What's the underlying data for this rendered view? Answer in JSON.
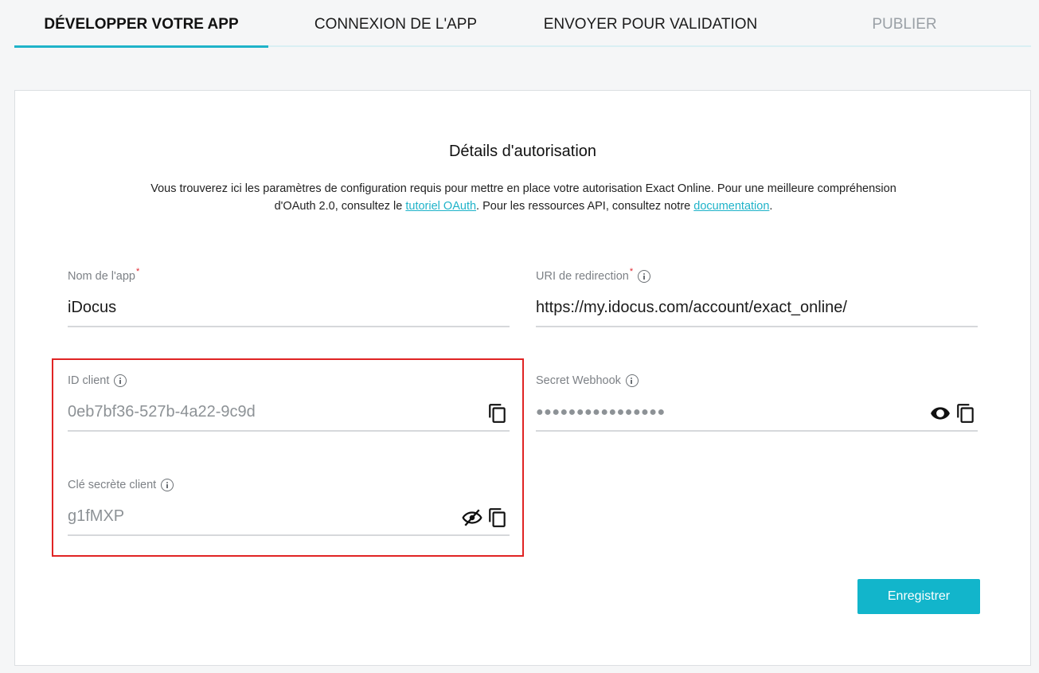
{
  "tabs": [
    {
      "label": "DÉVELOPPER VOTRE APP",
      "state": "active"
    },
    {
      "label": "CONNEXION DE L'APP",
      "state": "normal"
    },
    {
      "label": "ENVOYER POUR VALIDATION",
      "state": "normal"
    },
    {
      "label": "PUBLIER",
      "state": "disabled"
    }
  ],
  "card": {
    "title": "Détails d'autorisation",
    "desc_part1": "Vous trouverez ici les paramètres de configuration requis pour mettre en place votre autorisation Exact Online. Pour une meilleure compréhension d'OAuth 2.0, consultez le ",
    "desc_link1": "tutoriel OAuth",
    "desc_part2": ". Pour les ressources API, consultez notre ",
    "desc_link2": "documentation",
    "desc_part3": "."
  },
  "fields": {
    "app_name": {
      "label": "Nom de l'app",
      "required_mark": "*",
      "value": "iDocus"
    },
    "redirect_uri": {
      "label": "URI de redirection",
      "required_mark": "*",
      "value": "https://my.idocus.com/account/exact_online/"
    },
    "client_id": {
      "label": "ID client",
      "value": "0eb7bf36-527b-4a22-9c9d"
    },
    "webhook_secret": {
      "label": "Secret Webhook",
      "value": "●●●●●●●●●●●●●●●●"
    },
    "client_secret": {
      "label": "Clé secrète client",
      "value": "g1fMXP"
    }
  },
  "icons": {
    "info": "info-icon",
    "copy": "copy-icon",
    "show": "eye-icon",
    "hide": "eye-slash-icon"
  },
  "colors": {
    "accent": "#12b5cb",
    "highlight": "#e02424",
    "required": "#e0262f"
  },
  "actions": {
    "save_label": "Enregistrer"
  }
}
